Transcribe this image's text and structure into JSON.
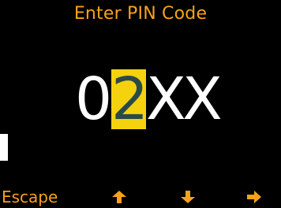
{
  "header": {
    "title": "Enter PIN Code"
  },
  "pin": {
    "digits": [
      "0",
      "2",
      "X",
      "X"
    ],
    "active_index": 1
  },
  "softkeys": {
    "escape_label": "Escape",
    "up_icon": "arrow-up-icon",
    "down_icon": "arrow-down-icon",
    "right_icon": "arrow-right-icon"
  },
  "colors": {
    "background": "#000000",
    "accent": "#f7a21b",
    "highlight": "#f5d20e",
    "digit": "#ffffff",
    "active_digit": "#2a4a48"
  }
}
